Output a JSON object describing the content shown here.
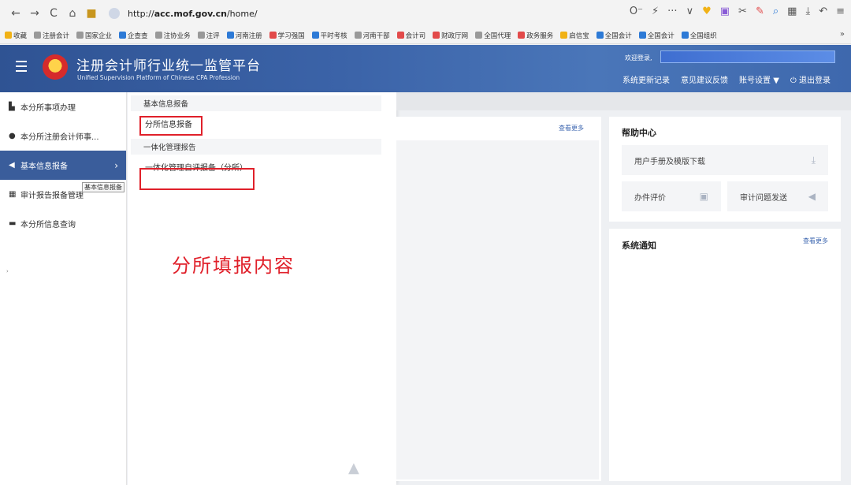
{
  "browser": {
    "back": "←",
    "forward": "→",
    "reload": "C",
    "home": "⌂",
    "url_prefix": "http://",
    "url_domain": "acc.mof.gov.cn",
    "url_path": "/home/",
    "right_icons": [
      "O⁻",
      "⚡",
      "···",
      "∨",
      "♥",
      "▣",
      "✂",
      "✎",
      "⌕",
      "▦",
      "⤓",
      "↶",
      "≡"
    ]
  },
  "bookmarks": [
    {
      "label": "收藏",
      "color": "#f1b216"
    },
    {
      "label": "注册会计",
      "color": "#999999"
    },
    {
      "label": "国家企业",
      "color": "#999999"
    },
    {
      "label": "企查查",
      "color": "#2d7ad6"
    },
    {
      "label": "注协业务",
      "color": "#999999"
    },
    {
      "label": "注评",
      "color": "#999999"
    },
    {
      "label": "河南注册",
      "color": "#2d7ad6"
    },
    {
      "label": "学习强国",
      "color": "#e24a4a"
    },
    {
      "label": "平时考核",
      "color": "#2d7ad6"
    },
    {
      "label": "河南干部",
      "color": "#999999"
    },
    {
      "label": "会计司",
      "color": "#e24a4a"
    },
    {
      "label": "财政厅网",
      "color": "#e24a4a"
    },
    {
      "label": "全国代理",
      "color": "#999999"
    },
    {
      "label": "政务服务",
      "color": "#e24a4a"
    },
    {
      "label": "启信宝",
      "color": "#f1b216"
    },
    {
      "label": "全国会计",
      "color": "#2d7ad6"
    },
    {
      "label": "全国会计",
      "color": "#2d7ad6"
    },
    {
      "label": "全国组织",
      "color": "#2d7ad6"
    }
  ],
  "bookmarks_more": "»",
  "header": {
    "title": "注册会计师行业统一监管平台",
    "subtitle": "Unified Supervision Platform of Chinese CPA Profession",
    "welcome": "欢迎登录,",
    "links": {
      "update_log": "系统更新记录",
      "feedback": "意见建议反馈",
      "account": "账号设置 ▼",
      "logout": "⏻ 退出登录"
    }
  },
  "sidebar": {
    "items": [
      {
        "icon": "▙",
        "label": "本分所事项办理"
      },
      {
        "icon": "👤",
        "label": "本分所注册会计师事..."
      },
      {
        "icon": "◀",
        "label": "基本信息报备",
        "arrow": "›"
      },
      {
        "icon": "▦",
        "label": "审计报告报备管理"
      },
      {
        "icon": "▬",
        "label": "本分所信息查询"
      }
    ],
    "tooltip": "基本信息报备"
  },
  "flyout": {
    "group1_title": "基本信息报备",
    "group1_link": "分所信息报备",
    "group2_title": "一体化管理报告",
    "group2_link": "一体化管理自评报备（分所）",
    "annotation": "分所填报内容"
  },
  "content": {
    "more1": "查看更多"
  },
  "help": {
    "title": "帮助中心",
    "manual": "用户手册及模版下载",
    "evaluate": "办件评价",
    "audit_issue": "审计问题发送"
  },
  "notice": {
    "title": "系统通知",
    "more": "查看更多"
  }
}
